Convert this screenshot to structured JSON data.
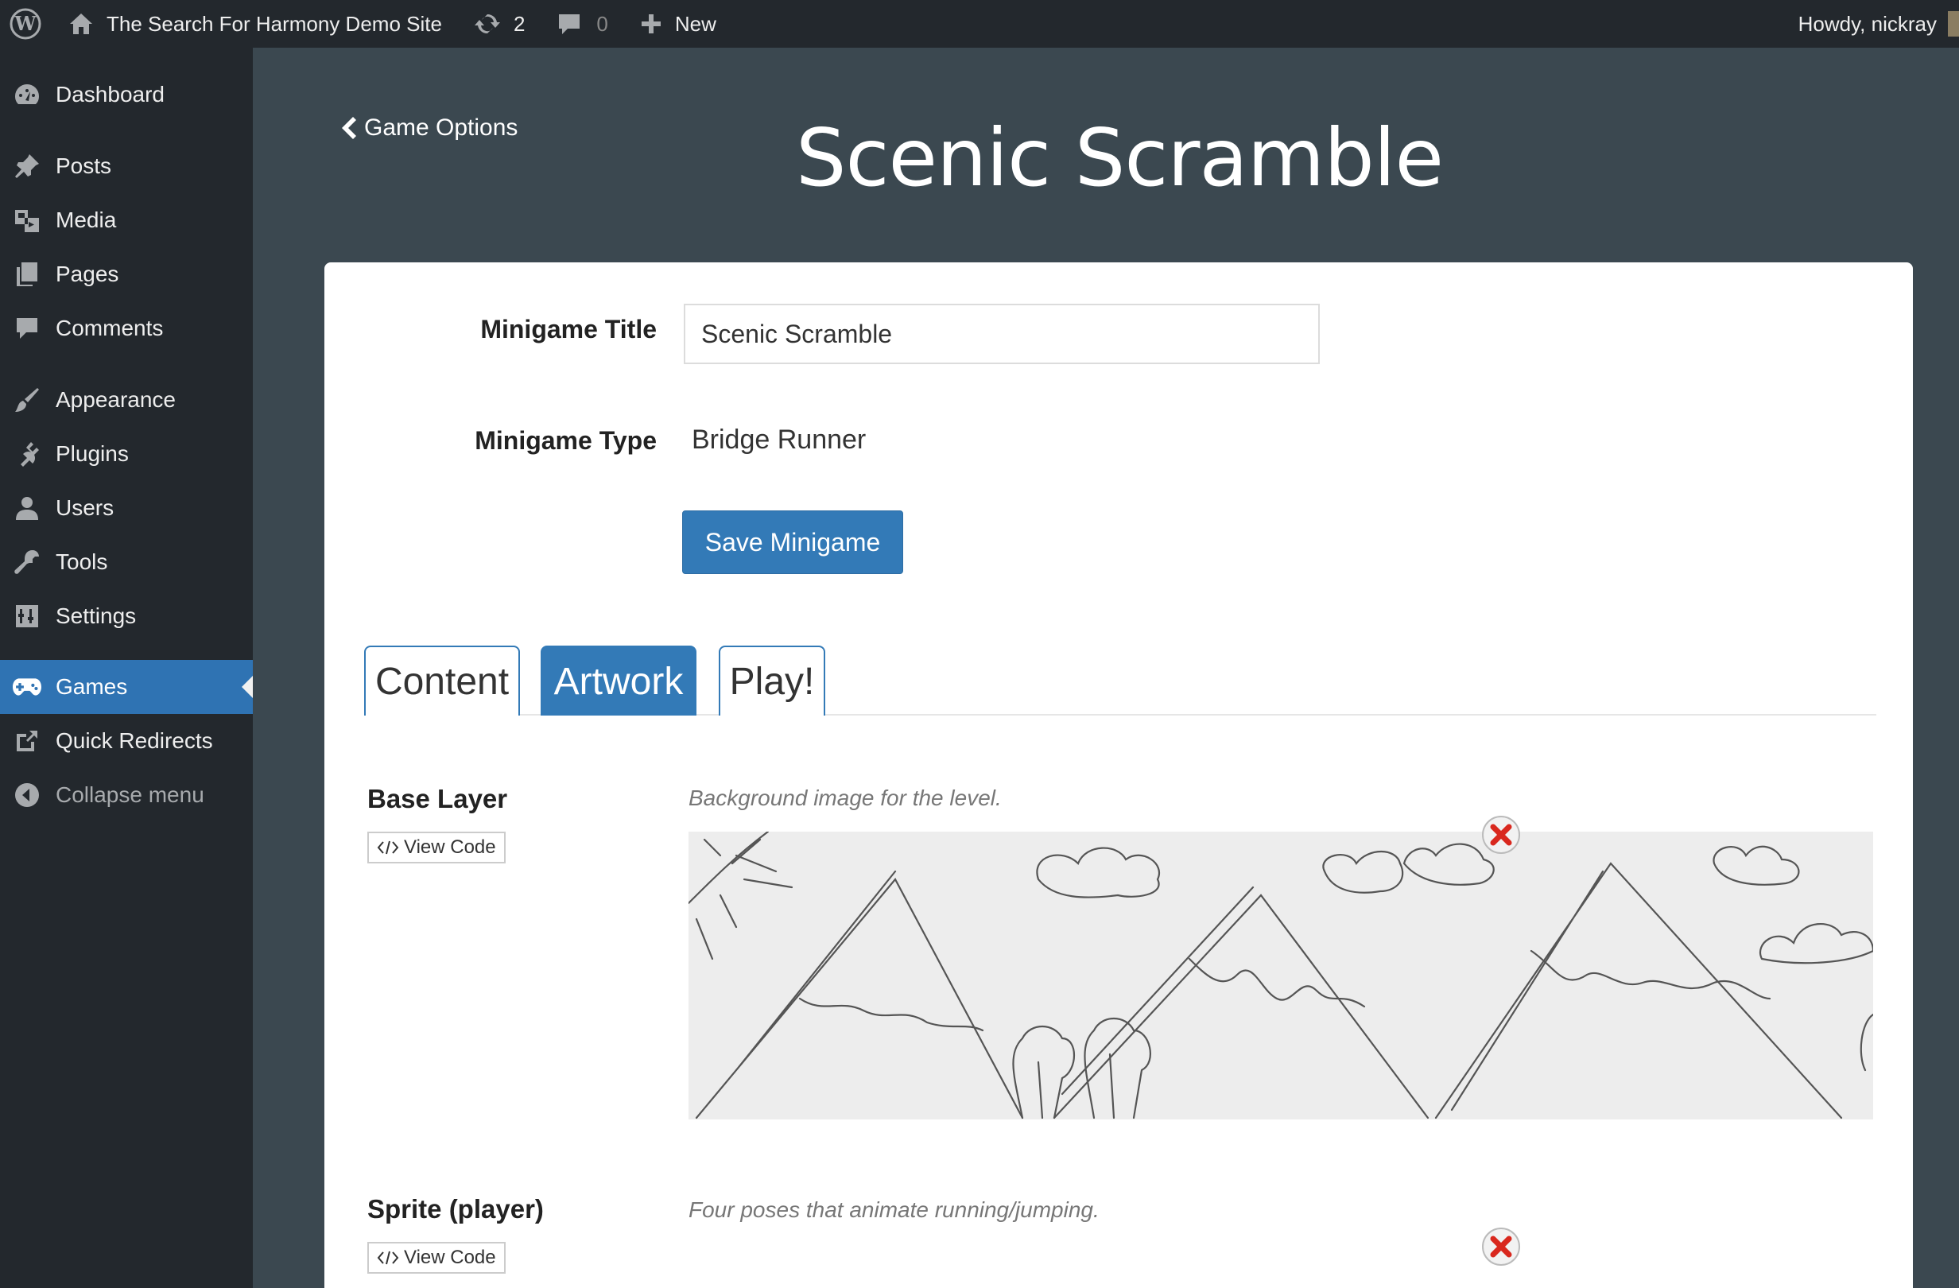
{
  "adminbar": {
    "site_name": "The Search For Harmony Demo Site",
    "updates_count": "2",
    "comments_count": "0",
    "new_label": "New",
    "howdy": "Howdy, nickray"
  },
  "sidebar": {
    "items": [
      {
        "label": "Dashboard",
        "icon": "dashboard-icon"
      },
      {
        "label": "Posts",
        "icon": "pushpin-icon"
      },
      {
        "label": "Media",
        "icon": "media-icon"
      },
      {
        "label": "Pages",
        "icon": "pages-icon"
      },
      {
        "label": "Comments",
        "icon": "comment-icon"
      },
      {
        "label": "Appearance",
        "icon": "paintbrush-icon"
      },
      {
        "label": "Plugins",
        "icon": "plugin-icon"
      },
      {
        "label": "Users",
        "icon": "user-icon"
      },
      {
        "label": "Tools",
        "icon": "wrench-icon"
      },
      {
        "label": "Settings",
        "icon": "settings-icon"
      },
      {
        "label": "Games",
        "icon": "gamepad-icon",
        "active": true
      },
      {
        "label": "Quick Redirects",
        "icon": "external-link-icon"
      },
      {
        "label": "Collapse menu",
        "icon": "collapse-icon"
      }
    ]
  },
  "header": {
    "back_label": "Game Options",
    "title": "Scenic Scramble"
  },
  "form": {
    "title_label": "Minigame Title",
    "title_value": "Scenic Scramble",
    "type_label": "Minigame Type",
    "type_value": "Bridge Runner",
    "save_label": "Save Minigame"
  },
  "tabs": [
    {
      "label": "Content",
      "active": false
    },
    {
      "label": "Artwork",
      "active": true
    },
    {
      "label": "Play!",
      "active": false
    }
  ],
  "layers": [
    {
      "name": "Base Layer",
      "view_code": "View Code",
      "description": "Background image for the level."
    },
    {
      "name": "Sprite (player)",
      "view_code": "View Code",
      "description": "Four poses that animate running/jumping."
    }
  ],
  "colors": {
    "admin_bar": "#23282d",
    "content_bg": "#3b4850",
    "accent": "#337ab7",
    "remove": "#d9281e"
  }
}
